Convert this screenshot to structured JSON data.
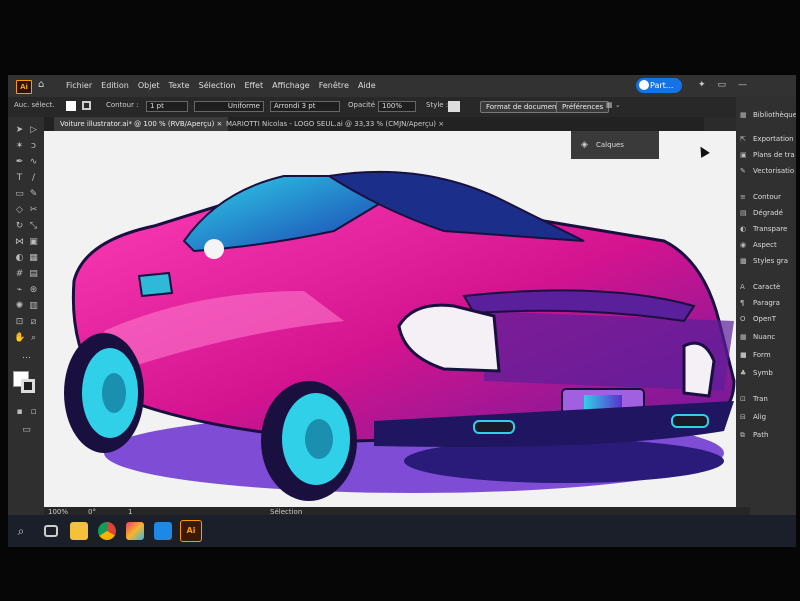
{
  "app": {
    "name": "Ai",
    "share_label": "Part..."
  },
  "menu": [
    "Fichier",
    "Edition",
    "Objet",
    "Texte",
    "Sélection",
    "Effet",
    "Affichage",
    "Fenêtre",
    "Aide"
  ],
  "control_bar": {
    "selection_state": "Auc. sélect.",
    "stroke_label": "Contour :",
    "stroke_value": "1 pt",
    "stroke_profile": "Uniforme",
    "brush": "Arrondi 3 pt",
    "opacity_label": "Opacité :",
    "opacity_value": "100%",
    "style_label": "Style :",
    "doc_format_button": "Format de document",
    "preferences_button": "Préférences"
  },
  "tabs": [
    {
      "label": "Voiture illustrator.ai* @ 100 % (RVB/Aperçu)",
      "active": true
    },
    {
      "label": "MARIOTTI Nicolas - LOGO SEUL.ai @ 33,33 % (CMJN/Aperçu)",
      "active": false
    }
  ],
  "layers_panel": {
    "label": "Calques"
  },
  "right_panel": {
    "top_label": "Bibliothèques",
    "items": [
      "Exportation",
      "Plans de tra",
      "Vectorisatio",
      "Contour",
      "Dégradé",
      "Transpare",
      "Aspect",
      "Styles gra",
      "Caractè",
      "Paragra",
      "OpenT",
      "Nuanc",
      "Form",
      "Symb",
      "Tran",
      "Alig",
      "Path"
    ]
  },
  "status_bar": {
    "zoom": "100%",
    "rotation": "0°",
    "page": "1",
    "tool_name": "Sélection"
  },
  "colors": {
    "ui_dark": "#2b2b2b",
    "canvas": "#f2f2f2",
    "accent": "#1473e6",
    "car_body": "#d4138f",
    "car_highlight": "#ff5ec4",
    "car_shadow": "#3b1a8a",
    "wheel": "#2fd0e8"
  },
  "taskbar_icons": [
    "search-icon",
    "task-view-icon",
    "explorer-icon",
    "chrome-icon",
    "photos-icon",
    "gallery-icon",
    "illustrator-icon"
  ]
}
